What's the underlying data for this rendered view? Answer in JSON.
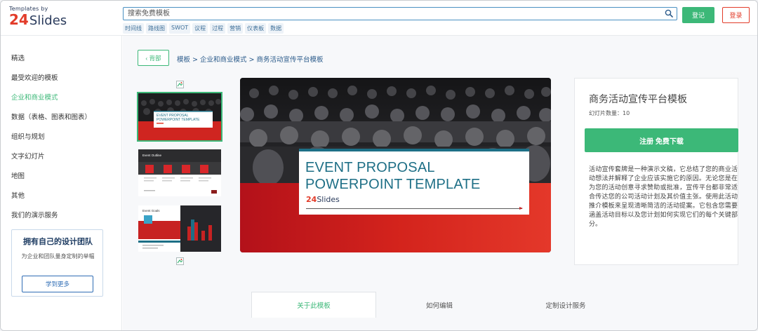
{
  "header": {
    "logo_small": "Templates by",
    "logo_num": "24",
    "logo_word": "Slides",
    "search_placeholder": "搜索免费模板",
    "tags": [
      "时间线",
      "路线图",
      "SWOT",
      "议程",
      "过程",
      "营销",
      "仪表板",
      "数据"
    ],
    "register_label": "登记",
    "login_label": "登录"
  },
  "sidebar": {
    "items": [
      {
        "label": "精选"
      },
      {
        "label": "最受欢迎的模板"
      },
      {
        "label": "企业和商业模式"
      },
      {
        "label": "数据（表格、图表和图表）"
      },
      {
        "label": "组织与规划"
      },
      {
        "label": "文字幻灯片"
      },
      {
        "label": "地图"
      },
      {
        "label": "其他"
      },
      {
        "label": "我们的演示服务"
      }
    ],
    "active_index": 2,
    "promo": {
      "title": "拥有自己的设计团队",
      "desc": "为企业和团队量身定制的举幅",
      "button": "学到更多"
    }
  },
  "main": {
    "back_label": "‹ 背部",
    "breadcrumb": "模板 > 企业和商业模式 > 商务活动宣传平台模板",
    "thumbs": [
      {
        "title": "EVENT PROPOSAL POWERPOINT TEMPLATE",
        "selected": true
      },
      {
        "title": "Event Outline",
        "selected": false
      },
      {
        "title": "Event Goals",
        "selected": false
      }
    ],
    "preview": {
      "line1": "EVENT PROPOSAL",
      "line2": "POWERPOINT TEMPLATE",
      "brand_num": "24",
      "brand_word": "Slides"
    },
    "info": {
      "title": "商务活动宣传平台模板",
      "slide_count": "幻灯片数量：10",
      "download_label": "注册 免费下载",
      "description": "活动宣传套牌是一种演示文稿，它总结了您的商业活动想法并解释了企业应该实施它的原因。无论您是在为您的活动创意寻求赞助或批准，宣传平台都非常适合传达您的公司活动计划及其价值主张。使用此活动推介模板来呈现清晰简洁的活动提案。它包含您需要涵盖活动目标以及您计划如何实现它们的每个关键部分。"
    },
    "tabs": [
      {
        "label": "关于此模板",
        "active": true
      },
      {
        "label": "如何编辑",
        "active": false
      },
      {
        "label": "定制设计服务",
        "active": false
      }
    ]
  },
  "colors": {
    "accent_green": "#3cb878",
    "brand_red": "#e23c2a",
    "teal": "#1e6f86",
    "navy": "#2a3b5c"
  }
}
